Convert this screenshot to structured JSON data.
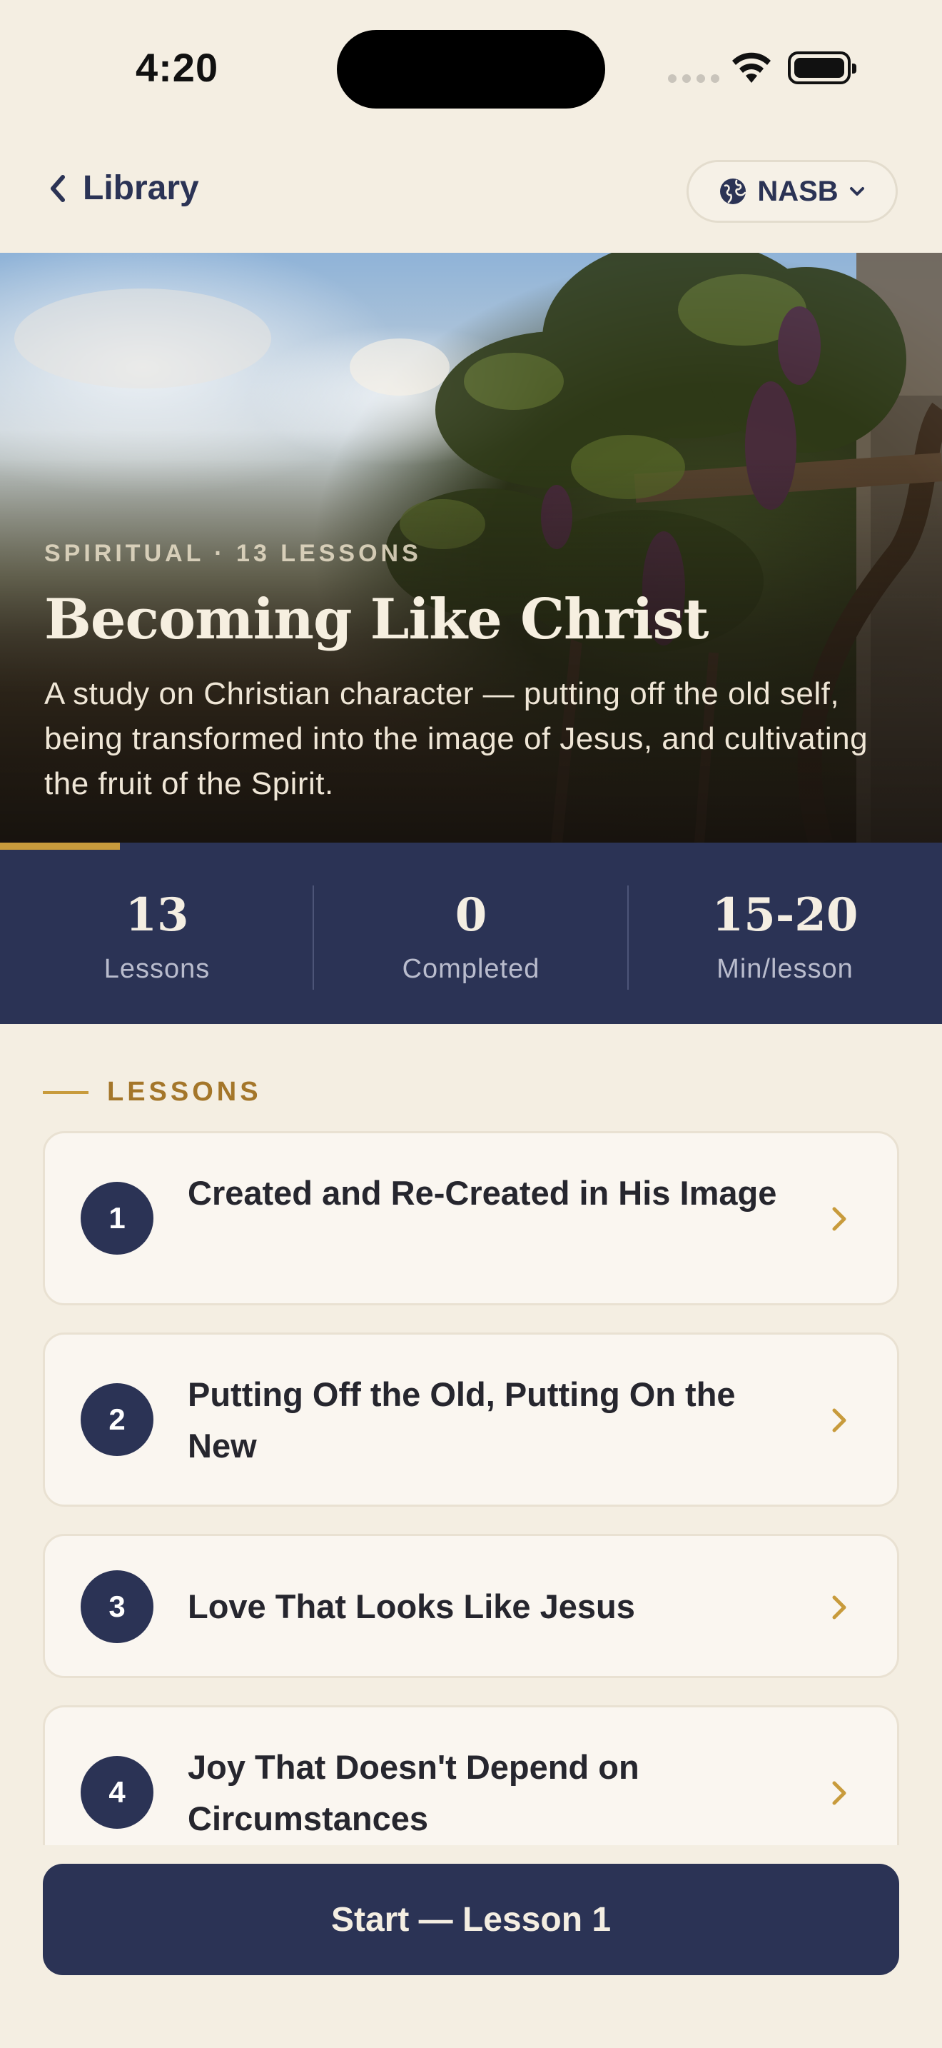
{
  "status_bar": {
    "time": "4:20"
  },
  "nav": {
    "back_label": "Library",
    "translation": "NASB"
  },
  "hero": {
    "meta": "SPIRITUAL · 13 LESSONS",
    "title": "Becoming Like Christ",
    "description": "A study on Christian character — putting off the old self, being transformed into the image of Jesus, and cultivating the fruit of the Spirit.",
    "progress": 0.127
  },
  "stats": [
    {
      "value": "13",
      "label": "Lessons"
    },
    {
      "value": "0",
      "label": "Completed"
    },
    {
      "value": "15-20",
      "label": "Min/lesson"
    }
  ],
  "lessons_section": {
    "label": "LESSONS"
  },
  "lessons": [
    {
      "number": "1",
      "title": "Created and Re-Created in His Image"
    },
    {
      "number": "2",
      "title": "Putting Off the Old, Putting On the New"
    },
    {
      "number": "3",
      "title": "Love That Looks Like Jesus"
    },
    {
      "number": "4",
      "title": "Joy That Doesn't Depend on Circumstances"
    }
  ],
  "start_button": {
    "label": "Start — Lesson 1"
  },
  "colors": {
    "background": "#f4eee2",
    "navy": "#2b3355",
    "gold": "#c89b3c",
    "card": "#faf6f0"
  }
}
